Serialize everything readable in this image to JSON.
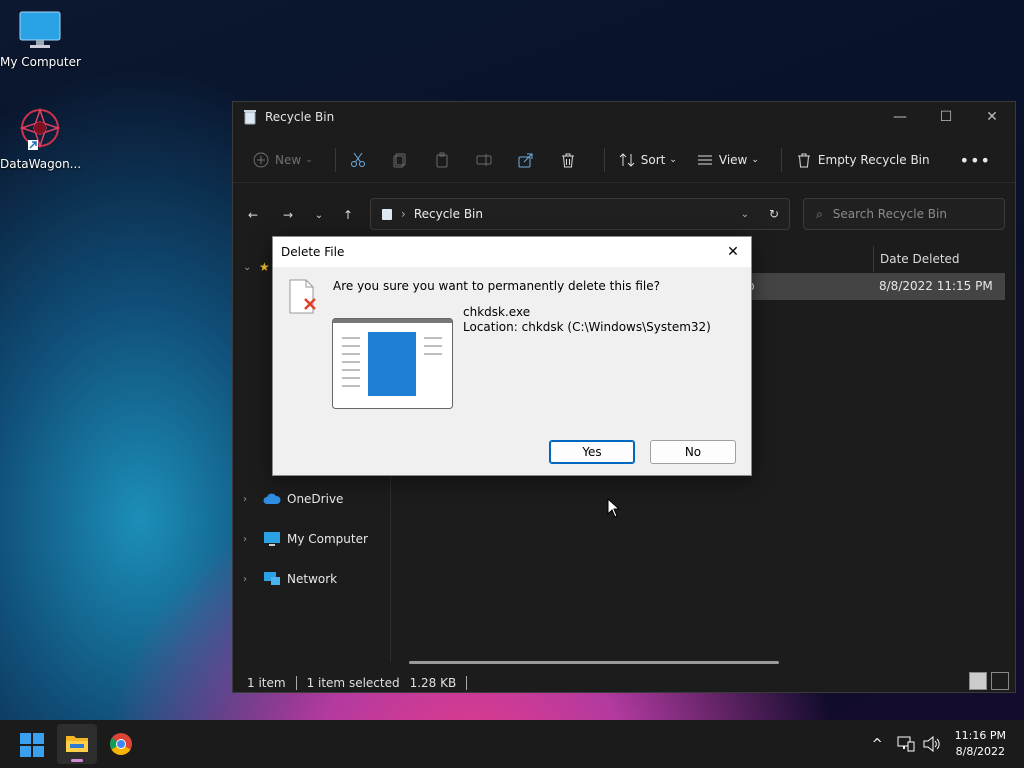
{
  "desktop": {
    "icons": [
      {
        "label": "My Computer"
      },
      {
        "label": "DataWagon..."
      }
    ]
  },
  "explorer": {
    "title": "Recycle Bin",
    "toolbar": {
      "new_label": "New",
      "sort_label": "Sort",
      "view_label": "View",
      "empty_label": "Empty Recycle Bin"
    },
    "address": "Recycle Bin",
    "search_placeholder": "Search Recycle Bin",
    "nav": [
      {
        "label": "OneDrive"
      },
      {
        "label": "My Computer"
      },
      {
        "label": "Network"
      }
    ],
    "columns": {
      "date_deleted": "Date Deleted"
    },
    "row": {
      "name_fragment": "p",
      "date_deleted": "8/8/2022 11:15 PM"
    },
    "status": {
      "count": "1 item",
      "selected": "1 item selected",
      "size": "1.28 KB"
    }
  },
  "dialog": {
    "title": "Delete File",
    "question": "Are you sure you want to permanently delete this file?",
    "file_name": "chkdsk.exe",
    "location": "Location: chkdsk (C:\\Windows\\System32)",
    "yes_label": "Yes",
    "no_label": "No"
  },
  "taskbar": {
    "time": "11:16 PM",
    "date": "8/8/2022"
  },
  "colors": {
    "accent": "#0067c0",
    "selection": "#444444"
  }
}
